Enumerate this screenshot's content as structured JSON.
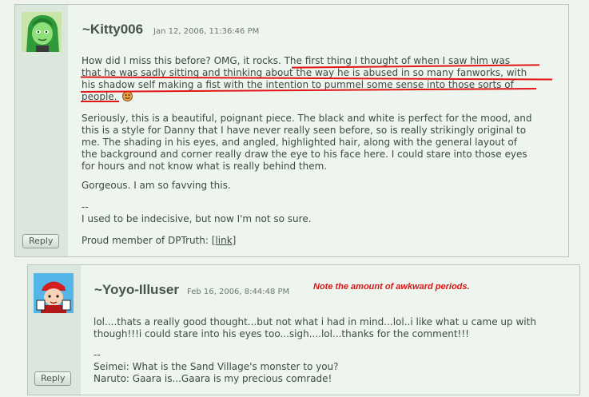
{
  "comments": [
    {
      "username": "~Kitty006",
      "date": "Jan 12, 2006, 11:36:46 PM",
      "reply_label": "Reply",
      "para1_lines": [
        "How did I miss this before? OMG, it rocks. The first thing I thought of when I saw him was",
        "that he was sadly sitting and thinking about the way he is abused in so many fanworks, with",
        "his shadow self making a fist with the intention to pummel some sense into those sorts of",
        "people."
      ],
      "para2_lines": [
        "Seriously, this is a beautiful, poignant piece. The black and white is perfect for the mood, and",
        "this is a style for Danny that I have never really seen before, so is really strikingly original to",
        "me. The shading in his eyes, and angled, highlighted hair, along with the general layout of",
        "the background and corner really draw the eye to his face here. I could stare into those eyes",
        "for hours and not know what is really behind them."
      ],
      "para3": "Gorgeous. I am so favving this.",
      "sig_dash": "--",
      "sig_line": "I used to be indecisive, but now I'm not so sure.",
      "proud": "Proud member of DPTruth:",
      "proud_link": "[link]"
    },
    {
      "username": "~Yoyo-Illuser",
      "date": "Feb 16, 2006, 8:44:48 PM",
      "reply_label": "Reply",
      "annotation": "Note the amount of awkward periods.",
      "body_lines": [
        "lol....thats a really good thought...but not what i had in mind...lol..i like what u came up with",
        "though!!!i could stare into his eyes too...sigh....lol...thanks for the comment!!!"
      ],
      "sig_dash": "--",
      "sig_lines": [
        "Seimei: What is the Sand Village's monster to you?",
        "Naruto: Gaara is...Gaara is my precious comrade!"
      ]
    }
  ],
  "icons": {
    "emoticon": "smiley-face-icon",
    "avatar1": "green-girl-avatar-icon",
    "avatar2": "red-cap-avatar-icon"
  },
  "colors": {
    "annotation": "#d91616",
    "underline": "#e11616"
  }
}
